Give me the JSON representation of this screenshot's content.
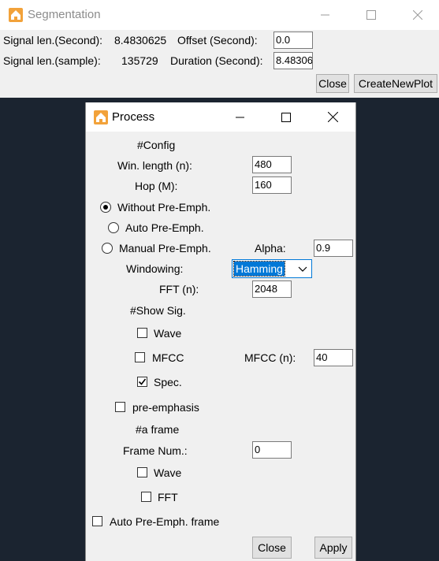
{
  "segmentation": {
    "title": "Segmentation",
    "signal_len_second_label": "Signal len.(Second):",
    "signal_len_second_value": "8.4830625",
    "offset_label": "Offset (Second):",
    "offset_value": "0.0",
    "signal_len_sample_label": "Signal len.(sample):",
    "signal_len_sample_value": "135729",
    "duration_label": "Duration (Second):",
    "duration_value": "8.48306",
    "close_label": "Close",
    "create_plot_label": "CreateNewPlot"
  },
  "process": {
    "title": "Process",
    "config_header": "#Config",
    "win_length_label": "Win. length (n):",
    "win_length_value": "480",
    "hop_label": "Hop (M):",
    "hop_value": "160",
    "without_preemph_label": "Without Pre-Emph.",
    "auto_preemph_label": "Auto Pre-Emph.",
    "manual_preemph_label": "Manual Pre-Emph.",
    "alpha_label": "Alpha:",
    "alpha_value": "0.9",
    "windowing_label": "Windowing:",
    "windowing_value": "Hamming",
    "fft_label": "FFT (n):",
    "fft_value": "2048",
    "show_sig_header": "#Show Sig.",
    "wave_label": "Wave",
    "mfcc_label": "MFCC",
    "mfcc_n_label": "MFCC (n):",
    "mfcc_n_value": "40",
    "spec_label": "Spec.",
    "spec_checked": true,
    "preemphasis_label": "pre-emphasis",
    "frame_header": "#a frame",
    "frame_num_label": "Frame Num.:",
    "frame_num_value": "0",
    "frame_wave_label": "Wave",
    "frame_fft_label": "FFT",
    "auto_preemph_frame_label": "Auto Pre-Emph. frame",
    "close_label": "Close",
    "apply_label": "Apply",
    "selected_radio": "without"
  },
  "colors": {
    "desktop": "#1b2430",
    "selection": "#0078d7",
    "window_bg": "#f0f0f0"
  }
}
